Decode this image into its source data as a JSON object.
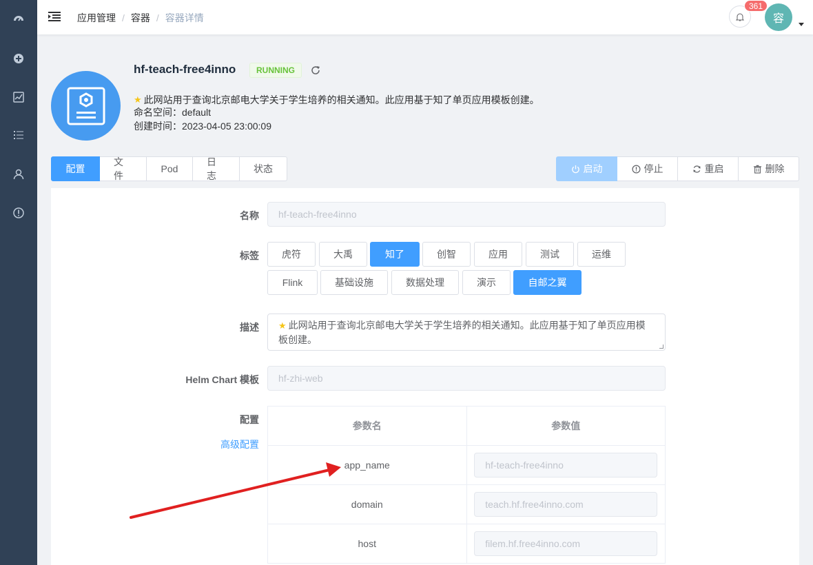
{
  "breadcrumb": [
    "应用管理",
    "容器",
    "容器详情"
  ],
  "notifications": {
    "count": "361"
  },
  "user": {
    "avatar_text": "容"
  },
  "app": {
    "name": "hf-teach-free4inno",
    "status": "RUNNING",
    "description": "此网站用于查询北京邮电大学关于学生培养的相关通知。此应用基于知了单页应用模板创建。",
    "namespace": "命名空间：default",
    "created": "创建时间：2023-04-05 23:00:09"
  },
  "tabs": [
    "配置",
    "文件",
    "Pod",
    "日志",
    "状态"
  ],
  "actions": {
    "start": "启动",
    "stop": "停止",
    "restart": "重启",
    "delete": "删除"
  },
  "form": {
    "name_label": "名称",
    "name_value": "hf-teach-free4inno",
    "tags_label": "标签",
    "tags": [
      {
        "label": "虎符",
        "selected": false
      },
      {
        "label": "大禹",
        "selected": false
      },
      {
        "label": "知了",
        "selected": true
      },
      {
        "label": "创智",
        "selected": false
      },
      {
        "label": "应用",
        "selected": false
      },
      {
        "label": "测试",
        "selected": false
      },
      {
        "label": "运维",
        "selected": false
      },
      {
        "label": "Flink",
        "selected": false
      },
      {
        "label": "基础设施",
        "selected": false
      },
      {
        "label": "数据处理",
        "selected": false
      },
      {
        "label": "演示",
        "selected": false
      },
      {
        "label": "自邮之翼",
        "selected": true
      }
    ],
    "desc_label": "描述",
    "desc_value_line1": "此网站用于查询北京邮电大学关于学生培养的相关通知。此应用基于知了单页应用模",
    "desc_value_line2": "板创建。",
    "helm_label": "Helm Chart 模板",
    "helm_value": "hf-zhi-web",
    "config_label": "配置",
    "advanced_link": "高级配置"
  },
  "params": {
    "headers": [
      "参数名",
      "参数值"
    ],
    "rows": [
      {
        "name": "app_name",
        "value": "hf-teach-free4inno"
      },
      {
        "name": "domain",
        "value": "teach.hf.free4inno.com"
      },
      {
        "name": "host",
        "value": "filem.hf.free4inno.com"
      }
    ]
  },
  "colors": {
    "primary": "#409eff",
    "sidebar": "#304156",
    "running": "#67c23a",
    "badge": "#f56c6c",
    "arrow": "#e02020"
  }
}
